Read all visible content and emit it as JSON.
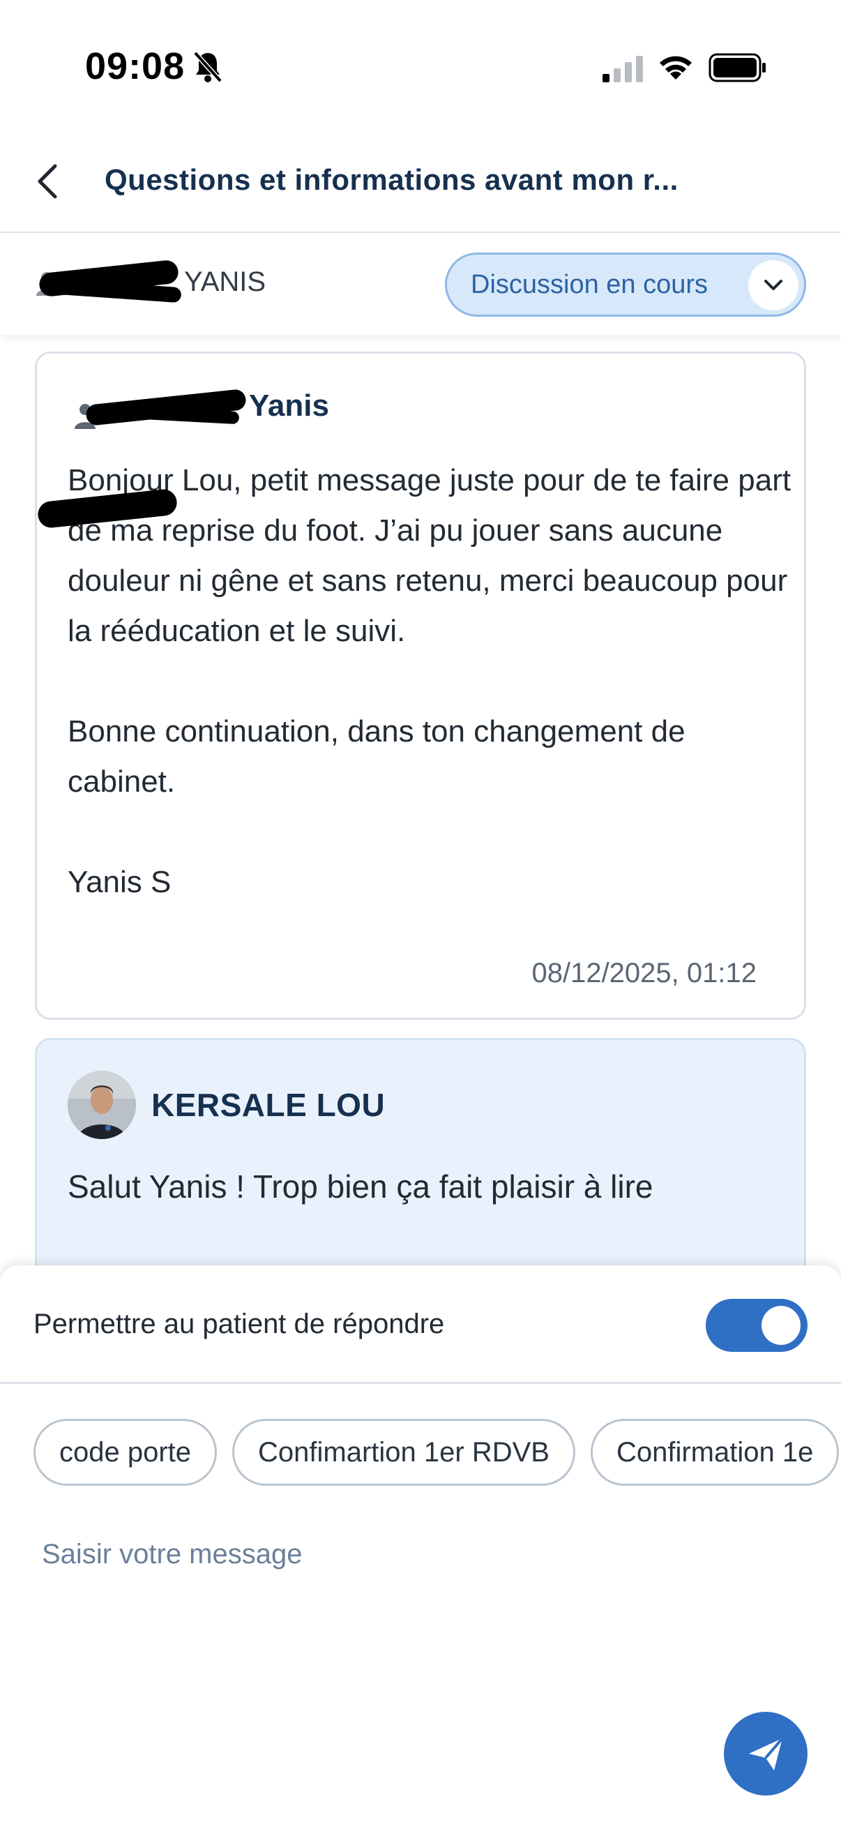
{
  "status_bar": {
    "time": "09:08",
    "icons": [
      "bell-off-icon",
      "signal-icon",
      "wifi-icon",
      "battery-icon"
    ]
  },
  "header": {
    "back_icon": "chevron-left-icon",
    "title": "Questions et informations avant mon r..."
  },
  "patient_bar": {
    "patient_name": "YANIS",
    "status": {
      "selected": "Discussion en cours",
      "icon": "chevron-down-icon"
    }
  },
  "messages": [
    {
      "sender": "Yanis",
      "body": "Bonjour Lou, petit message juste pour de te faire part de ma reprise du foot. J’ai pu jouer sans aucune douleur ni gêne et sans retenu, merci beaucoup pour la rééducation et le suivi.\n\nBonne continuation, dans ton changement de cabinet.\n\nYanis S",
      "timestamp": "08/12/2025, 01:12"
    },
    {
      "sender": "KERSALE LOU",
      "body": "Salut Yanis ! Trop bien ça fait plaisir à lire"
    }
  ],
  "compose": {
    "reply_toggle_label": "Permettre au patient de répondre",
    "reply_toggle_on": true,
    "quick_replies": [
      "code porte",
      "Confimartion 1er RDVB",
      "Confirmation 1e"
    ],
    "placeholder": "Saisir votre message",
    "send_icon": "send-icon"
  },
  "colors": {
    "primary": "#2f6fc4",
    "title": "#16304f",
    "status_pill_bg": "#d7e8fa",
    "staff_card_bg": "#e9f2fc"
  }
}
